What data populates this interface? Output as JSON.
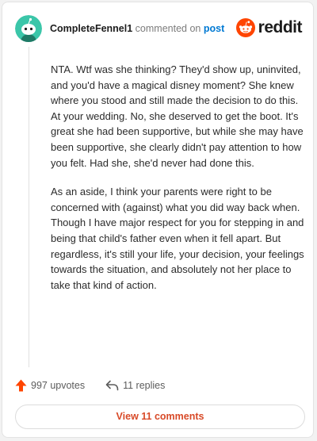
{
  "header": {
    "username": "CompleteFennel1",
    "action_text": "commented on",
    "post_link": "post",
    "brand": "reddit"
  },
  "comment": {
    "paragraphs": [
      "NTA. Wtf was she thinking? They'd show up, uninvited, and you'd have a magical disney moment? She knew where you stood and still made the decision to do this. At your wedding. No, she deserved to get the boot. It's great she had been supportive, but while she may have been supportive, she clearly didn't pay attention to how you felt. Had she, she'd never had done this.",
      "As an aside, I think your parents were right to be concerned with (against) what you did way back when. Though I have major respect for you for stepping in and being that child's father even when it fell apart. But regardless, it's still your life, your decision, your feelings towards the situation, and absolutely not her place to take that kind of action."
    ]
  },
  "footer": {
    "upvotes": "997 upvotes",
    "replies": "11 replies",
    "view_comments": "View 11 comments"
  },
  "icons": {
    "avatar": "snoo-avatar-icon",
    "brand": "reddit-logo-icon",
    "upvote": "upvote-arrow-icon",
    "reply": "reply-arrow-icon"
  },
  "colors": {
    "accent": "#ff4500",
    "link": "#0079d3",
    "avatar_bg": "#3bc6a9",
    "view_button_text": "#d84a28"
  }
}
